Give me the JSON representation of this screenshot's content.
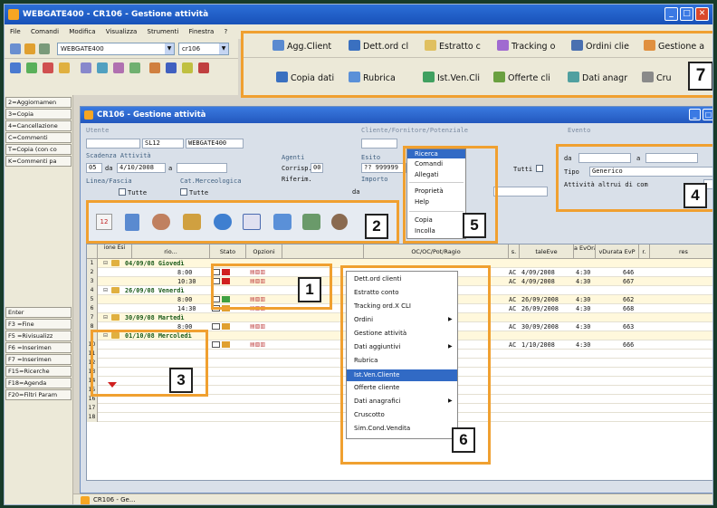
{
  "window": {
    "title": "WEBGATE400 - CR106 - Gestione attività"
  },
  "menu": [
    "File",
    "Comandi",
    "Modifica",
    "Visualizza",
    "Strumenti",
    "Finestra",
    "?"
  ],
  "toolbar_combo": {
    "server": "WEBGATE400",
    "program": "cr106"
  },
  "function_keys": [
    "2=Aggiornamen",
    "3=Copia",
    "4=Cancellazione",
    "C=Commenti",
    "T=Copia (con co",
    "K=Commenti pa"
  ],
  "function_keys_bottom": [
    "Enter",
    "F3 =Fine",
    "F5 =Rivisualizz",
    "F6 =Inserimen",
    "F7 =Inserimen",
    "F15=Ricerche",
    "F18=Agenda",
    "F20=Filtri Param"
  ],
  "toolbar_buttons": {
    "row1": [
      "Agg.Client",
      "Dett.ord cl",
      "Estratto c",
      "Tracking o",
      "Ordini clie",
      "Gestione a"
    ],
    "row2": [
      "Copia dati",
      "Rubrica",
      "Ist.Ven.Cli",
      "Offerte cli",
      "Dati anagr",
      "Cru"
    ]
  },
  "inner_window": {
    "title": "CR106 - Gestione attività"
  },
  "form": {
    "utente_label": "Utente",
    "utente_code": "SL12",
    "utente_value": "WEBGATE400",
    "cliente_label": "Cliente/Fornitore/Potenziale",
    "evento_label": "Evento",
    "scadenza_label": "Scadenza Attività",
    "scadenza_code": "05",
    "da_label": "da",
    "scadenza_da": "4/10/2008",
    "a_label": "a",
    "agenti_label": "Agenti",
    "corrisp_label": "Corrisp.",
    "corrisp_value": "00",
    "riferim_label": "Riferim.",
    "esito_label": "Esito",
    "esito_value": "?? 999999",
    "importo_label": "Importo",
    "tutti_label": "Tutti",
    "linea_label": "Linea/Fascia",
    "linea_tutte": "Tutte",
    "catmerc_label": "Cat.Merceologica",
    "catmerc_tutte": "Tutte",
    "evento_da": "da",
    "evento_a": "a",
    "tipo_label": "Tipo",
    "tipo_value": "Generico",
    "attivita_altrui": "Attività altrui di com"
  },
  "context_menu_top": [
    "Ricerca",
    "Comandi",
    "Allegati",
    "Proprietà",
    "Help",
    "Copia",
    "Incolla"
  ],
  "grid": {
    "headers": [
      "ione\nEsi",
      "rio...",
      "Stato",
      "Opzioni",
      "OC/OC/Pot/Ragio",
      "s.",
      "taleEve",
      "a EvOra",
      "vDurata EvP",
      "r.",
      "res"
    ],
    "rows": [
      {
        "n": "1",
        "label": "04/09/08 Giovedì",
        "group": true
      },
      {
        "n": "2",
        "time": "8:00",
        "s": "AC",
        "date": "4/09/2008",
        "ora": "4:30",
        "dur": "646"
      },
      {
        "n": "3",
        "time": "10:30",
        "s": "AC",
        "date": "4/09/2008",
        "ora": "4:30",
        "dur": "667"
      },
      {
        "n": "4",
        "label": "26/09/08 Venerdì",
        "group": true
      },
      {
        "n": "5",
        "time": "8:00",
        "s": "AC",
        "date": "26/09/2008",
        "ora": "4:30",
        "dur": "662"
      },
      {
        "n": "6",
        "time": "14:30",
        "s": "AC",
        "date": "26/09/2008",
        "ora": "4:30",
        "dur": "668"
      },
      {
        "n": "7",
        "label": "30/09/08 Martedì",
        "group": true
      },
      {
        "n": "8",
        "time": "8:00",
        "s": "AC",
        "date": "30/09/2008",
        "ora": "4:30",
        "dur": "663"
      },
      {
        "n": "9",
        "label": "01/10/08 Mercoledì",
        "group": true
      },
      {
        "n": "10",
        "time": "",
        "s": "AC",
        "date": "1/10/2008",
        "ora": "4:30",
        "dur": "666"
      },
      {
        "n": "11"
      },
      {
        "n": "12"
      },
      {
        "n": "13"
      },
      {
        "n": "14"
      },
      {
        "n": "15"
      },
      {
        "n": "16"
      },
      {
        "n": "17"
      },
      {
        "n": "18"
      }
    ]
  },
  "context_menu_grid": [
    "Dett.ord clienti",
    "Estratto conto",
    "Tracking ord.X CLI",
    "Ordini",
    "Gestione attività",
    "Dati aggiuntivi",
    "Rubrica",
    "Ist.Ven.Cliente",
    "Offerte cliente",
    "Dati anagrafici",
    "Cruscotto",
    "Sim.Cond.Vendita"
  ],
  "callouts": [
    "1",
    "2",
    "3",
    "4",
    "5",
    "6",
    "7"
  ],
  "taskbar": {
    "item": "CR106 - Ge..."
  },
  "colors": {
    "callout": "#f0a030",
    "title": "#2357bd",
    "highlight_row": "#fff3c4",
    "menu_selected": "#316ac5"
  }
}
